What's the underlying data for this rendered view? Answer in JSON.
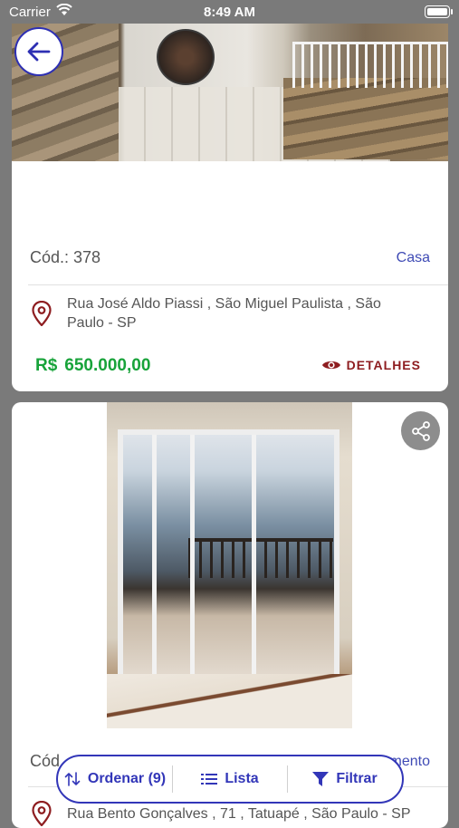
{
  "status_bar": {
    "carrier": "Carrier",
    "time": "8:49 AM"
  },
  "listings": [
    {
      "code": "Cód.: 378",
      "type": "Casa",
      "address": "Rua José Aldo Piassi , São Miguel Paulista , São Paulo - SP",
      "currency": "R$",
      "price": "650.000,00",
      "details_label": "DETALHES"
    },
    {
      "code": "Cód",
      "type": "mento",
      "address": "Rua Bento Gonçalves , 71 , Tatuapé , São Paulo - SP"
    }
  ],
  "bottom_bar": {
    "sort_label": "Ordenar (9)",
    "list_label": "Lista",
    "filter_label": "Filtrar"
  },
  "colors": {
    "accent": "#3236b8",
    "price": "#18a33a",
    "details": "#8e1d20",
    "pin": "#8e1d20"
  },
  "icons": [
    "back-arrow-icon",
    "location-pin-icon",
    "eye-icon",
    "share-icon",
    "sort-icon",
    "list-icon",
    "filter-icon",
    "wifi-icon",
    "battery-icon"
  ]
}
